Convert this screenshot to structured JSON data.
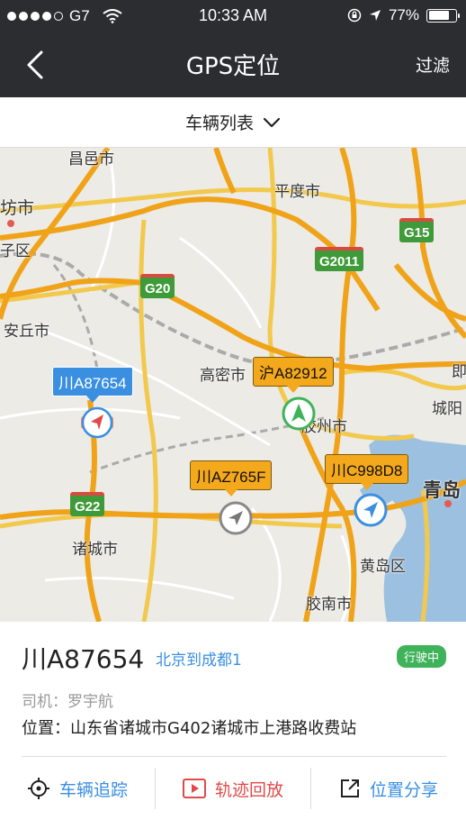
{
  "status_bar": {
    "carrier": "G7",
    "time": "10:33 AM",
    "battery": "77%",
    "battery_level": 0.77
  },
  "nav": {
    "title": "GPS定位",
    "filter_label": "过滤"
  },
  "list_selector": {
    "label": "车辆列表"
  },
  "map": {
    "cities": [
      "昌邑市",
      "坊市",
      "子区",
      "平度市",
      "安丘市",
      "高密市",
      "胶州市",
      "即",
      "城阳",
      "青岛",
      "诸城市",
      "黄岛区",
      "胶南市"
    ],
    "highways": [
      "G15",
      "G2011",
      "G20",
      "G22"
    ],
    "vehicles": [
      {
        "plate": "川A87654",
        "style": "blue"
      },
      {
        "plate": "沪A82912",
        "style": "orange"
      },
      {
        "plate": "川AZ765F",
        "style": "orange"
      },
      {
        "plate": "川C998D8",
        "style": "orange"
      }
    ]
  },
  "info": {
    "plate": "川A87654",
    "route": "北京到成都1",
    "status": "行驶中",
    "driver": "司机：罗宇航",
    "location": "位置：山东省诸城市G402诸城市上港路收费站"
  },
  "actions": {
    "track": "车辆追踪",
    "replay": "轨迹回放",
    "share": "位置分享"
  },
  "colors": {
    "accent": "#3a8fe0",
    "bar_bg": "#2b2d31",
    "status_green": "#3fb35a",
    "replay_red": "#e14a4a"
  }
}
